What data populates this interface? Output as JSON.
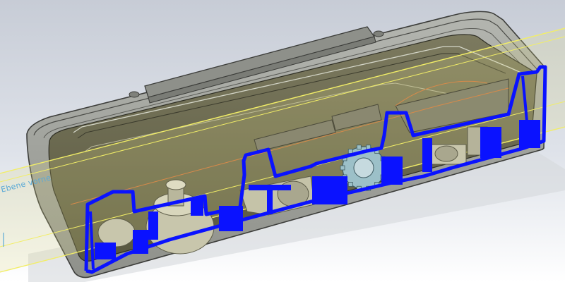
{
  "viewport": {
    "plane_label": "Ebene vorne"
  },
  "colors": {
    "background_top": "#c7ccd6",
    "background_mid": "#dfe3ea",
    "background_bottom": "#ffffff",
    "housing_shell": "#a3a59f",
    "housing_inner": "#6c6a52",
    "section_cut": "#0a12ff",
    "plane_edge": "#f2ee67",
    "plane_tint": "#e0d98a",
    "plane_label": "#5aa9d6",
    "internal_part": "#c8c6ac",
    "internal_part_dark": "#8b8a70",
    "gear": "#9cc0c8",
    "highlight_edge": "#d88a4a"
  },
  "icons": {
    "plane_marker": "plane-marker-icon"
  }
}
